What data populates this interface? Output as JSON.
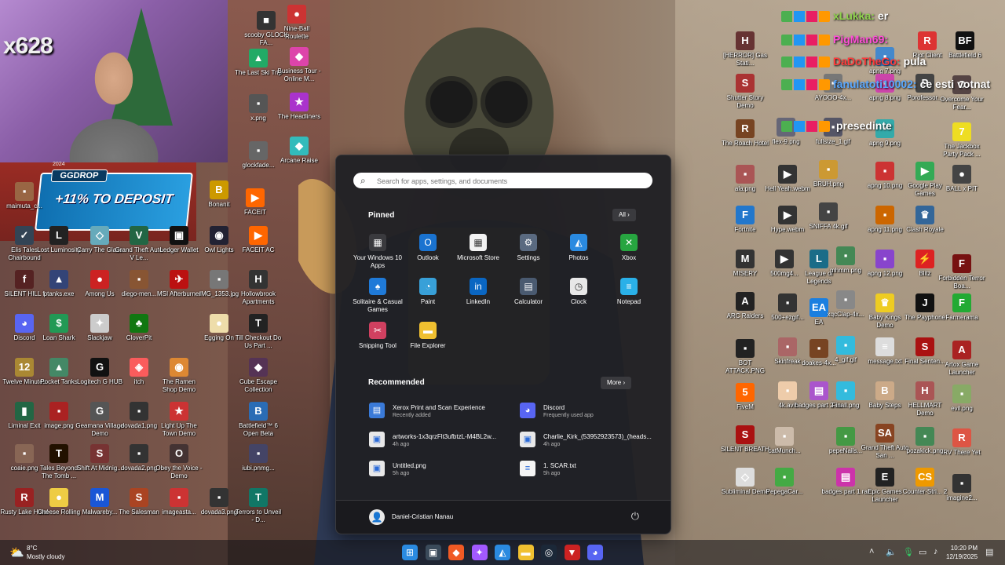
{
  "webcam": {
    "sub_count": "x628"
  },
  "promo": {
    "brand": "GGDROP",
    "offer": "+11% TO DEPOSIT",
    "year": "2024"
  },
  "chat": [
    {
      "name": "xLukka",
      "message": "er",
      "name_color": "#8fd14f"
    },
    {
      "name": "PigMan69",
      "message": "",
      "name_color": "#ff4fd8"
    },
    {
      "name": "DaDoTheGo",
      "message": "pula",
      "name_color": "#ff3b3b"
    },
    {
      "name": "fanulatoti10002",
      "message": "ce esti votnat",
      "name_color": "#5aa8ff"
    },
    {
      "name": "",
      "message": "presedinte",
      "name_color": "#cccccc"
    }
  ],
  "desktop_icons": [
    {
      "label": "scooby GLOCK FA...",
      "icon": "folder-icon",
      "color": "#333",
      "glyph": "■"
    },
    {
      "label": "Nine-Ball Roulette",
      "icon": "game-icon",
      "color": "#c33",
      "glyph": "●"
    },
    {
      "label": "The Last Ski Trip",
      "icon": "game-icon",
      "color": "#2a6",
      "glyph": "▲"
    },
    {
      "label": "Business Tour - Online M...",
      "icon": "game-icon",
      "color": "#d4a",
      "glyph": "◆"
    },
    {
      "label": "x.png",
      "icon": "image-icon",
      "color": "#555",
      "glyph": "▪"
    },
    {
      "label": "The Headliners",
      "icon": "game-icon",
      "color": "#a3c",
      "glyph": "★"
    },
    {
      "label": "glockfade...",
      "icon": "image-icon",
      "color": "#666",
      "glyph": "▪"
    },
    {
      "label": "Arcane Raise",
      "icon": "game-icon",
      "color": "#3bb",
      "glyph": "◆"
    },
    {
      "label": "maimuta_c...",
      "icon": "image-icon",
      "color": "#964",
      "glyph": "▪"
    },
    {
      "label": "Bonanit",
      "icon": "game-icon",
      "color": "#c90",
      "glyph": "B"
    },
    {
      "label": "FACEIT",
      "icon": "faceit-icon",
      "color": "#f60",
      "glyph": "▶"
    },
    {
      "label": "Elis Tales Chairbound",
      "icon": "game-icon",
      "color": "#345",
      "glyph": "✓"
    },
    {
      "label": "Lost Luminosity",
      "icon": "game-icon",
      "color": "#222",
      "glyph": "L"
    },
    {
      "label": "Carry The Glass",
      "icon": "game-icon",
      "color": "#6ab",
      "glyph": "◇"
    },
    {
      "label": "Grand Theft Auto V Le...",
      "icon": "game-icon",
      "color": "#264",
      "glyph": "V"
    },
    {
      "label": "Ledger Wallet",
      "icon": "wallet-icon",
      "color": "#111",
      "glyph": "▣"
    },
    {
      "label": "Owl Lights",
      "icon": "game-icon",
      "color": "#223",
      "glyph": "◉"
    },
    {
      "label": "FACEIT AC",
      "icon": "faceit-icon",
      "color": "#f60",
      "glyph": "▶"
    },
    {
      "label": "SILENT HILL f",
      "icon": "game-icon",
      "color": "#522",
      "glyph": "f"
    },
    {
      "label": "ptanks.exe",
      "icon": "app-icon",
      "color": "#347",
      "glyph": "▲"
    },
    {
      "label": "Among Us",
      "icon": "game-icon",
      "color": "#c22",
      "glyph": "●"
    },
    {
      "label": "diego-men...",
      "icon": "image-icon",
      "color": "#853",
      "glyph": "▪"
    },
    {
      "label": "MSI Afterburner",
      "icon": "app-icon",
      "color": "#b11",
      "glyph": "✈"
    },
    {
      "label": "IMG_1353.jpg",
      "icon": "image-icon",
      "color": "#777",
      "glyph": "▪"
    },
    {
      "label": "Hollowbrook Apartments",
      "icon": "game-icon",
      "color": "#333",
      "glyph": "H"
    },
    {
      "label": "Discord",
      "icon": "discord-icon",
      "color": "#5865f2",
      "glyph": "◕"
    },
    {
      "label": "Loan Shark",
      "icon": "game-icon",
      "color": "#295",
      "glyph": "$"
    },
    {
      "label": "Slackjaw",
      "icon": "game-icon",
      "color": "#ccc",
      "glyph": "✦"
    },
    {
      "label": "CloverPit",
      "icon": "game-icon",
      "color": "#171",
      "glyph": "♣"
    },
    {
      "label": "Egging On",
      "icon": "game-icon",
      "color": "#eda",
      "glyph": "●"
    },
    {
      "label": "Till Checkout Do Us Part ...",
      "icon": "game-icon",
      "color": "#222",
      "glyph": "T"
    },
    {
      "label": "Twelve Minutes",
      "icon": "game-icon",
      "color": "#a83",
      "glyph": "12"
    },
    {
      "label": "Pocket Tanks",
      "icon": "game-icon",
      "color": "#486",
      "glyph": "▲"
    },
    {
      "label": "Logitech G HUB",
      "icon": "app-icon",
      "color": "#111",
      "glyph": "G"
    },
    {
      "label": "itch",
      "icon": "itch-icon",
      "color": "#fa5c5c",
      "glyph": "◈"
    },
    {
      "label": "The Ramen Shop Demo",
      "icon": "game-icon",
      "color": "#d83",
      "glyph": "◉"
    },
    {
      "label": "Cube Escape Collection",
      "icon": "game-icon",
      "color": "#535",
      "glyph": "◆"
    },
    {
      "label": "Liminal Exit",
      "icon": "game-icon",
      "color": "#264",
      "glyph": "▮"
    },
    {
      "label": "image.png",
      "icon": "image-icon",
      "color": "#a22",
      "glyph": "▪"
    },
    {
      "label": "Geamana Village Demo",
      "icon": "game-icon",
      "color": "#555",
      "glyph": "G"
    },
    {
      "label": "dovada1.png",
      "icon": "image-icon",
      "color": "#333",
      "glyph": "▪"
    },
    {
      "label": "Light Up The Town Demo",
      "icon": "game-icon",
      "color": "#c33",
      "glyph": "★"
    },
    {
      "label": "Battlefield™ 6 Open Beta",
      "icon": "game-icon",
      "color": "#2a6cb5",
      "glyph": "B"
    },
    {
      "label": "coaie.png",
      "icon": "image-icon",
      "color": "#865",
      "glyph": "▪"
    },
    {
      "label": "Tales Beyond The Tomb ...",
      "icon": "game-icon",
      "color": "#210",
      "glyph": "T"
    },
    {
      "label": "Shift At Midnig...",
      "icon": "game-icon",
      "color": "#733",
      "glyph": "S"
    },
    {
      "label": "dovada2.png",
      "icon": "image-icon",
      "color": "#333",
      "glyph": "▪"
    },
    {
      "label": "Obey the Voice - Demo",
      "icon": "game-icon",
      "color": "#433",
      "glyph": "O"
    },
    {
      "label": "iubi.pnmg...",
      "icon": "image-icon",
      "color": "#446",
      "glyph": "▪"
    },
    {
      "label": "Rusty Lake Hotel",
      "icon": "game-icon",
      "color": "#922",
      "glyph": "R"
    },
    {
      "label": "Cheese Rolling",
      "icon": "game-icon",
      "color": "#ec4",
      "glyph": "●"
    },
    {
      "label": "Malwareby...",
      "icon": "app-icon",
      "color": "#1a56d6",
      "glyph": "M"
    },
    {
      "label": "The Salesman",
      "icon": "game-icon",
      "color": "#a42",
      "glyph": "S"
    },
    {
      "label": "imageasta...",
      "icon": "image-icon",
      "color": "#c33",
      "glyph": "▪"
    },
    {
      "label": "dovada3.png",
      "icon": "image-icon",
      "color": "#333",
      "glyph": "▪"
    },
    {
      "label": "Terrors to Unveil - D...",
      "icon": "game-icon",
      "color": "#176",
      "glyph": "T"
    },
    {
      "label": "[HERROR] Gas Stati...",
      "icon": "game-icon",
      "color": "#633",
      "glyph": "H"
    },
    {
      "label": "Shutter Story Demo",
      "icon": "game-icon",
      "color": "#a33",
      "glyph": "S"
    },
    {
      "label": "The Roach Hotel",
      "icon": "game-icon",
      "color": "#742",
      "glyph": "R"
    },
    {
      "label": "ala.png",
      "icon": "image-icon",
      "color": "#a55",
      "glyph": "▪"
    },
    {
      "label": "Fortnite",
      "icon": "game-icon",
      "color": "#27c",
      "glyph": "F"
    },
    {
      "label": "MISERY",
      "icon": "game-icon",
      "color": "#333",
      "glyph": "M"
    },
    {
      "label": "ARC Raiders",
      "icon": "game-icon",
      "color": "#222",
      "glyph": "A"
    },
    {
      "label": "BOT ATTACK.PNG",
      "icon": "image-icon",
      "color": "#222",
      "glyph": "▪"
    },
    {
      "label": "FiveM",
      "icon": "game-icon",
      "color": "#f60",
      "glyph": "5"
    },
    {
      "label": "SILENT BREATH",
      "icon": "game-icon",
      "color": "#a11",
      "glyph": "S"
    },
    {
      "label": "Subliminal Demo",
      "icon": "game-icon",
      "color": "#ddd",
      "glyph": "◇"
    },
    {
      "label": "Hell Yeah.webm",
      "icon": "video-icon",
      "color": "#333",
      "glyph": "▶"
    },
    {
      "label": "BRUH.png",
      "icon": "image-icon",
      "color": "#c93",
      "glyph": "▪"
    },
    {
      "label": "apng 10.png",
      "icon": "image-icon",
      "color": "#c33",
      "glyph": "▪"
    },
    {
      "label": "Google Play Games",
      "icon": "app-icon",
      "color": "#3a5",
      "glyph": "▶"
    },
    {
      "label": "BALL x PIT",
      "icon": "game-icon",
      "color": "#444",
      "glyph": "●"
    },
    {
      "label": "Hype.webm",
      "icon": "video-icon",
      "color": "#333",
      "glyph": "▶"
    },
    {
      "label": "SNIFFA 4k.gif",
      "icon": "image-icon",
      "color": "#444",
      "glyph": "▪"
    },
    {
      "label": "apng 11.png",
      "icon": "image-icon",
      "color": "#c60",
      "glyph": "▪"
    },
    {
      "label": "Clash Royale",
      "icon": "game-icon",
      "color": "#369",
      "glyph": "♛"
    },
    {
      "label": "500mg4...",
      "icon": "video-icon",
      "color": "#333",
      "glyph": "▶"
    },
    {
      "label": "League of Legends",
      "icon": "game-icon",
      "color": "#1a6c88",
      "glyph": "L"
    },
    {
      "label": "mhmm.png",
      "icon": "image-icon",
      "color": "#485",
      "glyph": "▪"
    },
    {
      "label": "apng 12.png",
      "icon": "image-icon",
      "color": "#84c",
      "glyph": "▪"
    },
    {
      "label": "Blitz",
      "icon": "app-icon",
      "color": "#d22",
      "glyph": "⚡"
    },
    {
      "label": "Forbidden Terror Boa...",
      "icon": "game-icon",
      "color": "#711",
      "glyph": "F"
    },
    {
      "label": "500+ezgif...",
      "icon": "image-icon",
      "color": "#333",
      "glyph": "▪"
    },
    {
      "label": "EA",
      "icon": "app-icon",
      "color": "#1a7fe0",
      "glyph": "EA"
    },
    {
      "label": "xqcClap-4x...",
      "icon": "image-icon",
      "color": "#888",
      "glyph": "▪"
    },
    {
      "label": "Baby Kings Demo",
      "icon": "game-icon",
      "color": "#ec2",
      "glyph": "♛"
    },
    {
      "label": "The Payphone",
      "icon": "game-icon",
      "color": "#111",
      "glyph": "J"
    },
    {
      "label": "Farmerama",
      "icon": "game-icon",
      "color": "#2a3",
      "glyph": "F"
    },
    {
      "label": "Skinfreak",
      "icon": "image-icon",
      "color": "#a66",
      "glyph": "▪"
    },
    {
      "label": "doakes-4x...",
      "icon": "image-icon",
      "color": "#742",
      "glyph": "▪"
    },
    {
      "label": "4_gif.gif",
      "icon": "image-icon",
      "color": "#3bd",
      "glyph": "▪"
    },
    {
      "label": "message.txt",
      "icon": "text-icon",
      "color": "#ddd",
      "glyph": "≡"
    },
    {
      "label": "Final Senten...",
      "icon": "game-icon",
      "color": "#a11",
      "glyph": "S"
    },
    {
      "label": "Artox Game Launcher",
      "icon": "game-icon",
      "color": "#a22",
      "glyph": "A"
    },
    {
      "label": "4k.avif",
      "icon": "image-icon",
      "color": "#eca",
      "glyph": "▪"
    },
    {
      "label": "badges part 2.rar",
      "icon": "archive-icon",
      "color": "#a5c",
      "glyph": "▤"
    },
    {
      "label": "Finall.png",
      "icon": "image-icon",
      "color": "#3bd",
      "glyph": "▪"
    },
    {
      "label": "Baby Steps",
      "icon": "game-icon",
      "color": "#ca8",
      "glyph": "B"
    },
    {
      "label": "HELLMART Demo",
      "icon": "game-icon",
      "color": "#a55",
      "glyph": "H"
    },
    {
      "label": "evil.png",
      "icon": "image-icon",
      "color": "#8a6",
      "glyph": "▪"
    },
    {
      "label": "catMunch...",
      "icon": "image-icon",
      "color": "#cba",
      "glyph": "▪"
    },
    {
      "label": "pepeNails...",
      "icon": "image-icon",
      "color": "#494",
      "glyph": "▪"
    },
    {
      "label": "Grand Theft Auto San ...",
      "icon": "game-icon",
      "color": "#842",
      "glyph": "SA"
    },
    {
      "label": "pozakick.png",
      "icon": "image-icon",
      "color": "#485",
      "glyph": "▪"
    },
    {
      "label": "RV There Yet",
      "icon": "game-icon",
      "color": "#d54",
      "glyph": "R"
    },
    {
      "label": "PepegaCar...",
      "icon": "image-icon",
      "color": "#4a4",
      "glyph": "▪"
    },
    {
      "label": "badges part 1.rar",
      "icon": "archive-icon",
      "color": "#c3a",
      "glyph": "▤"
    },
    {
      "label": "Epic Games Launcher",
      "icon": "app-icon",
      "color": "#222",
      "glyph": "E"
    },
    {
      "label": "Counter-Stri... 2",
      "icon": "game-icon",
      "color": "#e90",
      "glyph": "CS"
    },
    {
      "label": "imagine2...",
      "icon": "image-icon",
      "color": "#333",
      "glyph": "▪"
    },
    {
      "label": "Battlefield 6",
      "icon": "game-icon",
      "color": "#111",
      "glyph": "BF"
    },
    {
      "label": "Riot Client",
      "icon": "app-icon",
      "color": "#d33",
      "glyph": "R"
    },
    {
      "label": "apng 7.png",
      "icon": "image-icon",
      "color": "#48c",
      "glyph": "▪"
    },
    {
      "label": "apng 8.png",
      "icon": "image-icon",
      "color": "#c4a",
      "glyph": "▪"
    },
    {
      "label": "Porofessor...",
      "icon": "app-icon",
      "color": "#444",
      "glyph": "P"
    },
    {
      "label": "Overcome Your Fear...",
      "icon": "game-icon",
      "color": "#544",
      "glyph": "O"
    },
    {
      "label": "apng 9.png",
      "icon": "image-icon",
      "color": "#3aa",
      "glyph": "▪"
    },
    {
      "label": "The Jackbox Party Pack ...",
      "icon": "game-icon",
      "color": "#ed2",
      "glyph": "7"
    },
    {
      "label": "flex-9.png",
      "icon": "image-icon",
      "color": "#667",
      "glyph": "▪"
    },
    {
      "label": "fullsize_1.gif",
      "icon": "image-icon",
      "color": "#556",
      "glyph": "▪"
    },
    {
      "label": "AYOOO-4x...",
      "icon": "image-icon",
      "color": "#777",
      "glyph": "▪"
    }
  ],
  "start_menu": {
    "search_placeholder": "Search for apps, settings, and documents",
    "pinned_title": "Pinned",
    "all_button": "All",
    "pinned": [
      {
        "label": "Your Windows 10 Apps",
        "icon": "folder-apps-icon",
        "color": "#3a3a3e",
        "glyph": "▦"
      },
      {
        "label": "Outlook",
        "icon": "outlook-icon",
        "color": "#1a73d0",
        "glyph": "O"
      },
      {
        "label": "Microsoft Store",
        "icon": "store-icon",
        "color": "#f2f2f2",
        "glyph": "▦"
      },
      {
        "label": "Settings",
        "icon": "gear-icon",
        "color": "#5a6a80",
        "glyph": "⚙"
      },
      {
        "label": "Photos",
        "icon": "photos-icon",
        "color": "#2a8ae0",
        "glyph": "◭"
      },
      {
        "label": "Xbox",
        "icon": "xbox-icon",
        "color": "#27a540",
        "glyph": "✕"
      },
      {
        "label": "Solitaire & Casual Games",
        "icon": "solitaire-icon",
        "color": "#1f7ad8",
        "glyph": "♠"
      },
      {
        "label": "Paint",
        "icon": "paint-icon",
        "color": "#38a0d8",
        "glyph": "◔"
      },
      {
        "label": "LinkedIn",
        "icon": "linkedin-icon",
        "color": "#0a66c2",
        "glyph": "in"
      },
      {
        "label": "Calculator",
        "icon": "calculator-icon",
        "color": "#4a5a70",
        "glyph": "▤"
      },
      {
        "label": "Clock",
        "icon": "clock-icon",
        "color": "#e8e8e8",
        "glyph": "◷"
      },
      {
        "label": "Notepad",
        "icon": "notepad-icon",
        "color": "#2ab0e8",
        "glyph": "≡"
      },
      {
        "label": "Snipping Tool",
        "icon": "snipping-tool-icon",
        "color": "#d04060",
        "glyph": "✂"
      },
      {
        "label": "File Explorer",
        "icon": "folder-icon",
        "color": "#f0c030",
        "glyph": "▬"
      }
    ],
    "recommended_title": "Recommended",
    "more_button": "More",
    "recommended": [
      {
        "title": "Xerox Print and Scan Experience",
        "sub": "Recently added",
        "icon": "xerox-icon",
        "color": "#3a7ad8",
        "glyph": "▤"
      },
      {
        "title": "Discord",
        "sub": "Frequently used app",
        "icon": "discord-icon",
        "color": "#5865f2",
        "glyph": "◕"
      },
      {
        "title": "artworks-1x3qrzFlt3ufbtzL-M4BL2w...",
        "sub": "4h ago",
        "icon": "image-file-icon",
        "color": "#e8e8e8",
        "glyph": "▣"
      },
      {
        "title": "Charlie_Kirk_(53952923573)_(heads...",
        "sub": "4h ago",
        "icon": "image-file-icon",
        "color": "#e8e8e8",
        "glyph": "▣"
      },
      {
        "title": "Untitled.png",
        "sub": "5h ago",
        "icon": "image-file-icon",
        "color": "#e8e8e8",
        "glyph": "▣"
      },
      {
        "title": "1. SCAR.txt",
        "sub": "5h ago",
        "icon": "text-file-icon",
        "color": "#f4f4f4",
        "glyph": "≡"
      }
    ],
    "user_name": "Daniel-Cristian Nanau"
  },
  "taskbar": {
    "weather_temp": "8°C",
    "weather_desc": "Mostly cloudy",
    "apps": [
      {
        "name": "start",
        "icon": "windows-icon",
        "color": "#2a8ae0",
        "glyph": "⊞"
      },
      {
        "name": "task-view",
        "icon": "task-view-icon",
        "color": "#3a4a5a",
        "glyph": "▣"
      },
      {
        "name": "brave",
        "icon": "brave-icon",
        "color": "#f05a24",
        "glyph": "◆"
      },
      {
        "name": "figma",
        "icon": "figma-icon",
        "color": "#a259ff",
        "glyph": "✦"
      },
      {
        "name": "photos",
        "icon": "photos-icon",
        "color": "#2a8ae0",
        "glyph": "◭"
      },
      {
        "name": "file-explorer",
        "icon": "folder-icon",
        "color": "#f0c030",
        "glyph": "▬"
      },
      {
        "name": "steam",
        "icon": "steam-icon",
        "color": "#1b2838",
        "glyph": "◎"
      },
      {
        "name": "vanguard",
        "icon": "shield-icon",
        "color": "#c22",
        "glyph": "▼"
      },
      {
        "name": "discord",
        "icon": "discord-icon",
        "color": "#5865f2",
        "glyph": "◕"
      }
    ],
    "time": "10:20 PM",
    "date": "12/19/2025"
  }
}
